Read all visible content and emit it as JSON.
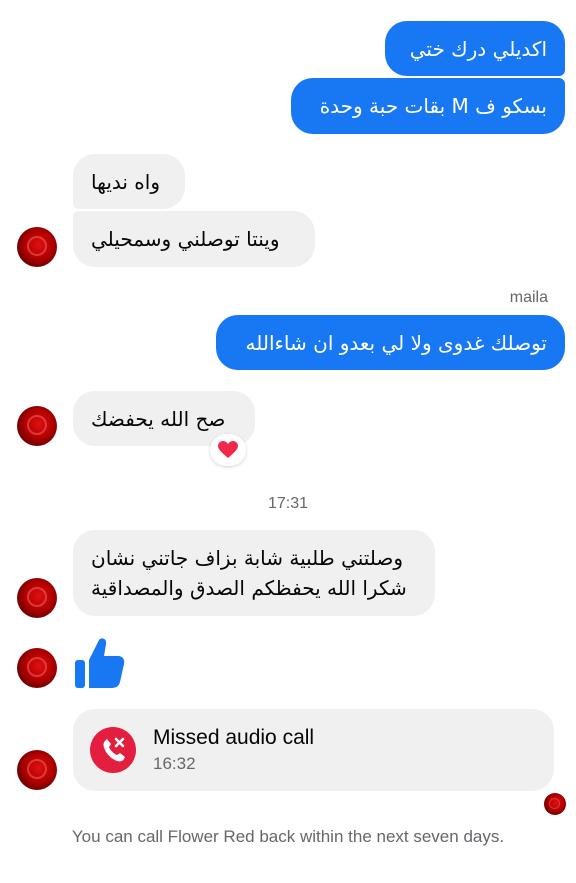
{
  "messages": {
    "out1": "اكديلي درك ختي",
    "out2": "بسكو ف M بقات حبة وحدة",
    "in1": "واه نديها",
    "in2": "وينتا توصلني وسمحيلي",
    "sender_name": "maila",
    "out3": "توصلك غدوى ولا لي بعدو ان شاءالله",
    "in3": "صح الله يحفضك",
    "in3_reaction": "heart",
    "timestamp": "17:31",
    "in4_line1": "وصلتني طلبية شابة بزاف جاتني نشان",
    "in4_line2": "شكرا الله يحفظكم الصدق والمصداقية",
    "thumbs_up": "thumbs-up-icon"
  },
  "call": {
    "title": "Missed audio call",
    "time": "16:32",
    "icon": "missed-call-icon"
  },
  "footer": {
    "notice": "You can call Flower Red back within the next seven days."
  },
  "colors": {
    "outgoing": "#1877f2",
    "incoming": "#f0f0f0",
    "missed_call": "#e41e3f",
    "heart": "#f02849"
  }
}
